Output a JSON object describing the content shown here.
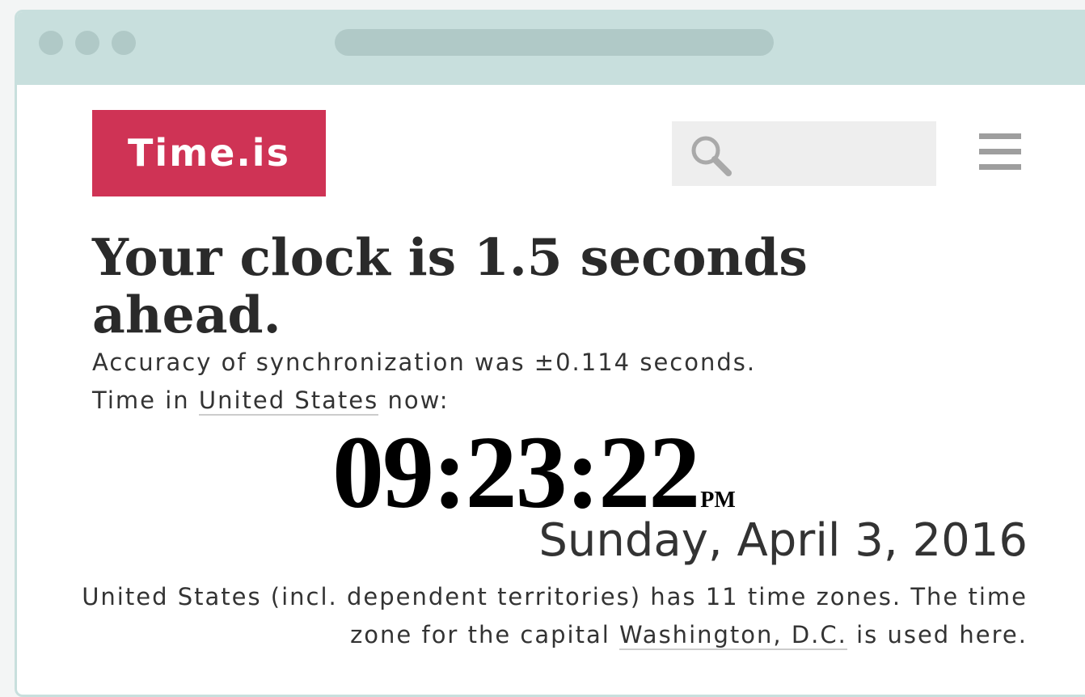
{
  "header": {
    "logo_text": "Time.is",
    "search_placeholder": "",
    "search_icon": "search-icon",
    "menu_icon": "hamburger-menu-icon"
  },
  "main": {
    "headline": "Your clock is 1.5 seconds ahead.",
    "accuracy": "Accuracy of synchronization was ±0.114 seconds.",
    "time_in_prefix": "Time in ",
    "country_link": "United States",
    "time_in_suffix": " now:",
    "clock_time": "09:23:22",
    "clock_ampm": "PM",
    "date": "Sunday, April 3, 2016",
    "note_part1": "United States (incl. dependent territories) has 11 time zones. The time zone for the capital ",
    "capital_link": "Washington, D.C.",
    "note_part2": " is used here."
  },
  "colors": {
    "brand": "#cf3355",
    "window_frame": "#c8dfdd",
    "window_controls": "#b0c9c7",
    "search_bg": "#eeeeee"
  }
}
